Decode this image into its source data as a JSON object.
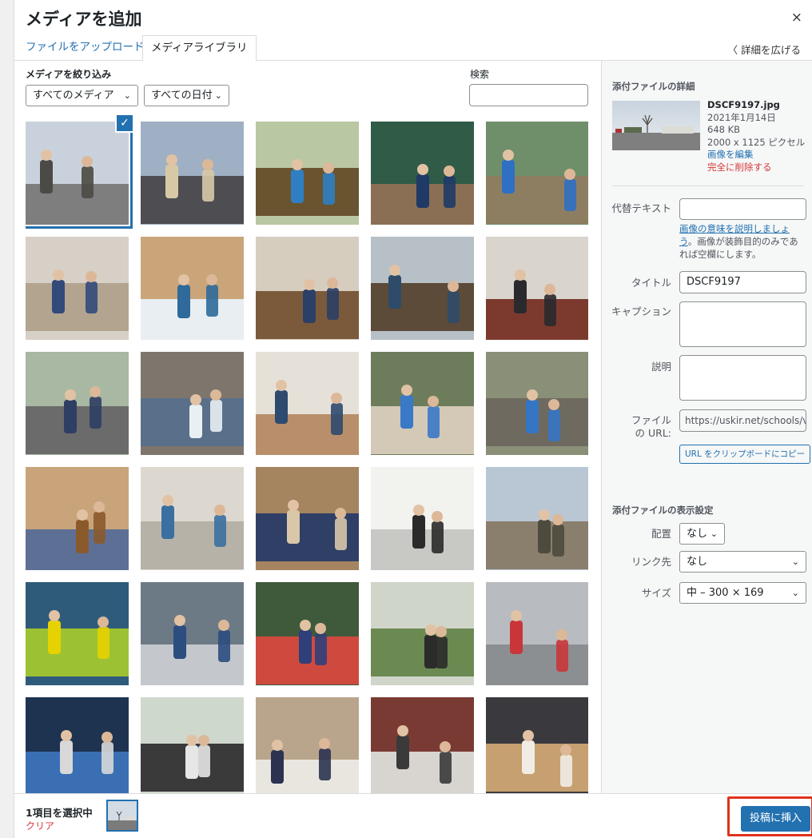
{
  "title": "メディアを追加",
  "close_glyph": "×",
  "tabs": [
    {
      "label": "ファイルをアップロード",
      "active": false
    },
    {
      "label": "メディアライブラリ",
      "active": true
    }
  ],
  "expand_label": "〈 詳細を広げる",
  "filters": {
    "label": "メディアを絞り込み",
    "media_type": "すべてのメディア",
    "date": "すべての日付",
    "search_label": "検索",
    "search_value": ""
  },
  "grid": {
    "selected_index": 0,
    "items": [
      {
        "id": "photo-01",
        "selected": true
      },
      {
        "id": "photo-02"
      },
      {
        "id": "photo-03"
      },
      {
        "id": "photo-04"
      },
      {
        "id": "photo-05"
      },
      {
        "id": "photo-06"
      },
      {
        "id": "photo-07"
      },
      {
        "id": "photo-08"
      },
      {
        "id": "photo-09"
      },
      {
        "id": "photo-10"
      },
      {
        "id": "photo-11"
      },
      {
        "id": "photo-12"
      },
      {
        "id": "photo-13"
      },
      {
        "id": "photo-14"
      },
      {
        "id": "photo-15"
      },
      {
        "id": "photo-16"
      },
      {
        "id": "photo-17"
      },
      {
        "id": "photo-18"
      },
      {
        "id": "photo-19"
      },
      {
        "id": "photo-20"
      },
      {
        "id": "photo-21"
      },
      {
        "id": "photo-22"
      },
      {
        "id": "photo-23"
      },
      {
        "id": "photo-24"
      },
      {
        "id": "photo-25"
      },
      {
        "id": "photo-26"
      },
      {
        "id": "photo-27"
      },
      {
        "id": "photo-28"
      },
      {
        "id": "photo-29"
      },
      {
        "id": "photo-30"
      }
    ]
  },
  "details": {
    "heading": "添付ファイルの詳細",
    "filename": "DSCF9197.jpg",
    "date": "2021年1月14日",
    "size": "648 KB",
    "dimensions": "2000 x 1125 ピクセル",
    "edit_link": "画像を編集",
    "delete_link": "完全に削除する",
    "alt_label": "代替テキスト",
    "alt_value": "",
    "alt_help_link": "画像の意味を説明しましょう",
    "alt_help_text": "。画像が装飾目的のみであれば空欄にします。",
    "title_label": "タイトル",
    "title_value": "DSCF9197",
    "caption_label": "キャプション",
    "caption_value": "",
    "description_label": "説明",
    "description_value": "",
    "url_label": "ファイルの URL:",
    "url_value": "https://uskir.net/schools/v",
    "copy_button": "URL をクリップボードにコピー"
  },
  "display_settings": {
    "heading": "添付ファイルの表示設定",
    "align_label": "配置",
    "align_value": "なし",
    "link_label": "リンク先",
    "link_value": "なし",
    "size_label": "サイズ",
    "size_value": "中 – 300 × 169"
  },
  "toolbar": {
    "selection_count": "1項目を選択中",
    "clear_label": "クリア",
    "insert_button": "投稿に挿入",
    "highlight_color": "#e0321c"
  },
  "colors": {
    "accent": "#2271b1",
    "danger": "#d63638"
  }
}
